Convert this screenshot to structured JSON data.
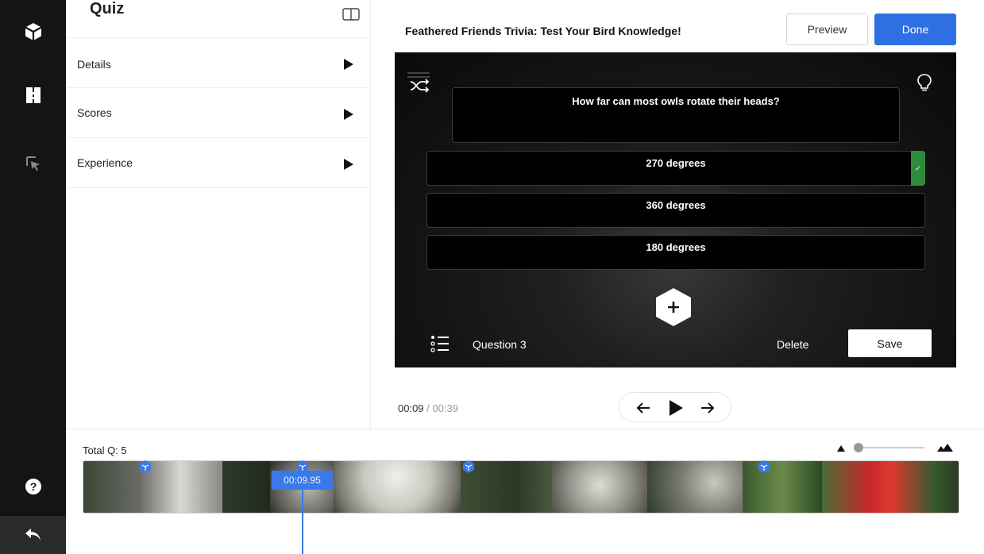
{
  "rail": {
    "items": [
      {
        "icon": "cube-icon"
      },
      {
        "icon": "chapters-icon"
      },
      {
        "icon": "cursor-select-icon"
      }
    ],
    "help_icon": "help-icon",
    "back_icon": "undo-icon"
  },
  "side_panel": {
    "title": "Quiz",
    "toggle_icon": "panel-toggle-icon",
    "sections": [
      {
        "label": "Details"
      },
      {
        "label": "Scores"
      },
      {
        "label": "Experience"
      }
    ]
  },
  "header": {
    "title": "Feathered Friends Trivia: Test Your Bird Knowledge!",
    "preview_label": "Preview",
    "done_label": "Done"
  },
  "stage": {
    "question": "How far can most owls rotate their heads?",
    "answers": [
      {
        "text": "270 degrees",
        "correct": true
      },
      {
        "text": "360 degrees",
        "correct": false
      },
      {
        "text": "180 degrees",
        "correct": false
      }
    ],
    "question_label": "Question 3",
    "delete_label": "Delete",
    "save_label": "Save"
  },
  "playback": {
    "current": "00:09",
    "separator": "/",
    "total": "00:39"
  },
  "timeline": {
    "total_q": "Total Q: 5",
    "playhead_time": "00:09.95"
  },
  "colors": {
    "accent": "#2f6fe4",
    "correct": "#2e8b3b",
    "rail": "#141414"
  }
}
